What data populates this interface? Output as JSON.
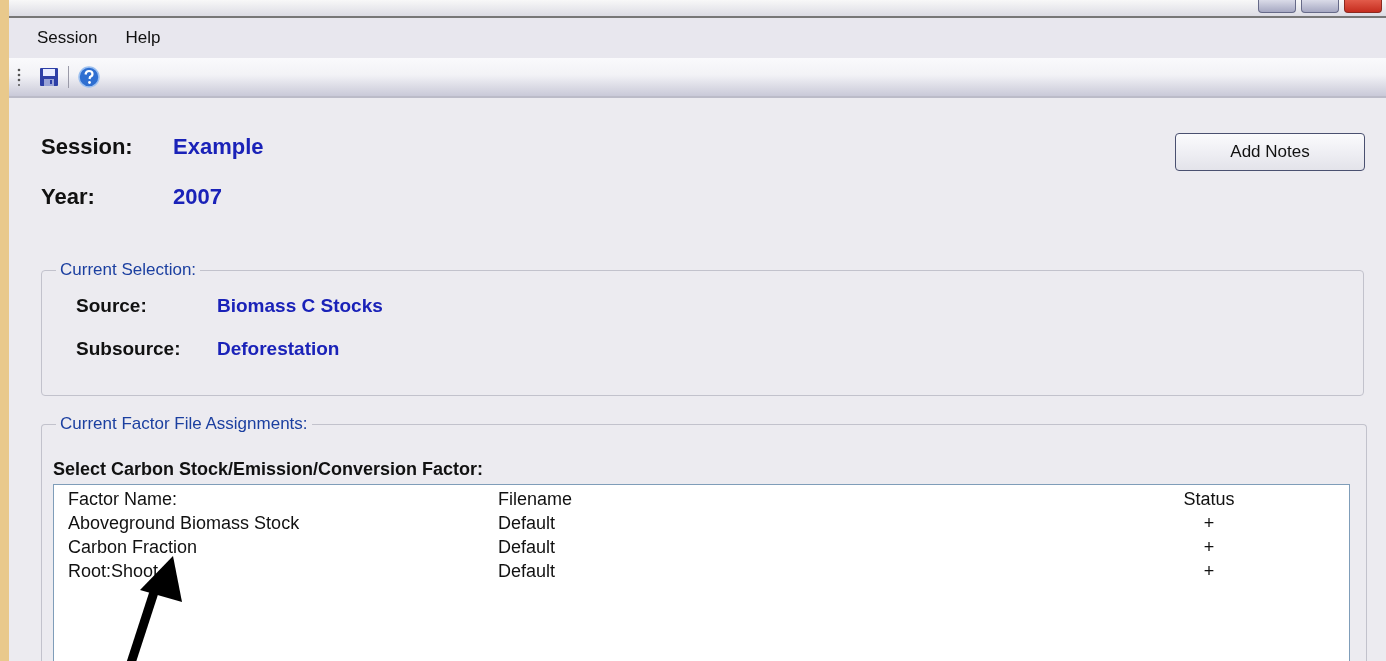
{
  "menu": [
    "Session",
    "Help"
  ],
  "toolbar": [
    {
      "kind": "save"
    },
    {
      "kind": "help"
    }
  ],
  "session": {
    "label": "Session:",
    "value": "Example"
  },
  "year": {
    "label": "Year:",
    "value": "2007"
  },
  "add_notes_button": "Add Notes",
  "current_selection": {
    "title": "Current Selection:",
    "fields": [
      {
        "label": "Source:",
        "value": "Biomass C Stocks"
      },
      {
        "label": "Subsource:",
        "value": "Deforestation"
      }
    ]
  },
  "factor_assignments": {
    "title": "Current Factor File Assignments:",
    "prompt": "Select Carbon Stock/Emission/Conversion Factor:",
    "columns": [
      "Factor Name:",
      "Filename",
      "Status"
    ],
    "rows": [
      [
        "Aboveground Biomass Stock",
        "Default",
        "+"
      ],
      [
        "Carbon Fraction",
        "Default",
        "+"
      ],
      [
        "Root:Shoot",
        "Default",
        "+"
      ]
    ]
  }
}
